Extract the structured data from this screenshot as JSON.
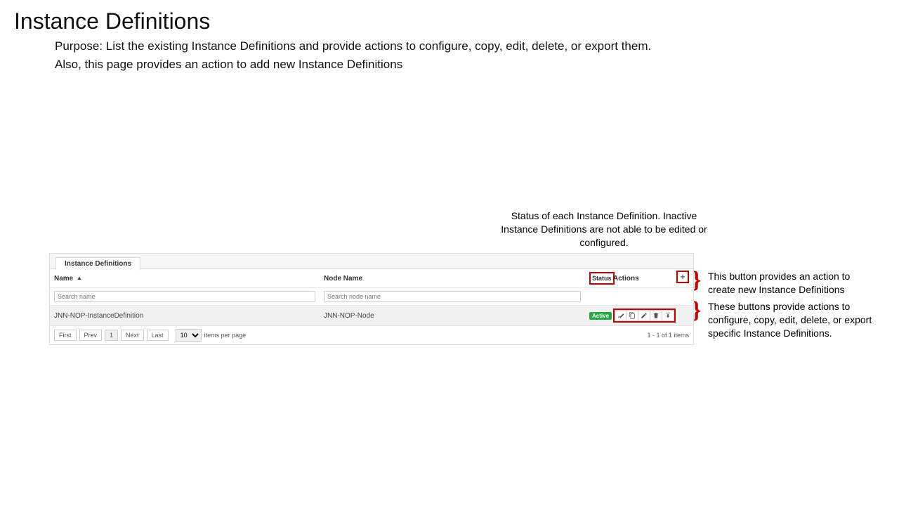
{
  "page": {
    "title": "Instance Definitions",
    "description_line1": "Purpose: List the existing Instance Definitions and provide actions to configure, copy, edit, delete, or export them.",
    "description_line2": "Also, this page provides an action to add new Instance Definitions"
  },
  "annotations": {
    "status_note": "Status of each Instance Definition. Inactive Instance Definitions are not able to be edited or configured.",
    "add_note": "This button provides an action to create new Instance Definitions",
    "actions_note": "These buttons provide actions to configure, copy, edit, delete, or export specific Instance Definitions."
  },
  "grid": {
    "tab_label": "Instance Definitions",
    "columns": {
      "name": "Name",
      "node_name": "Node Name",
      "status": "Status",
      "actions": "Actions"
    },
    "search": {
      "name_placeholder": "Search name",
      "node_placeholder": "Search node name"
    },
    "add_icon_label": "+",
    "rows": [
      {
        "name": "JNN-NOP-InstanceDefinition",
        "node_name": "JNN-NOP-Node",
        "status": "Active"
      }
    ]
  },
  "pager": {
    "first": "First",
    "prev": "Prev",
    "page": "1",
    "next": "Next",
    "last": "Last",
    "per_page": "10",
    "per_page_label": "items per page",
    "range": "1 - 1 of 1 items"
  }
}
